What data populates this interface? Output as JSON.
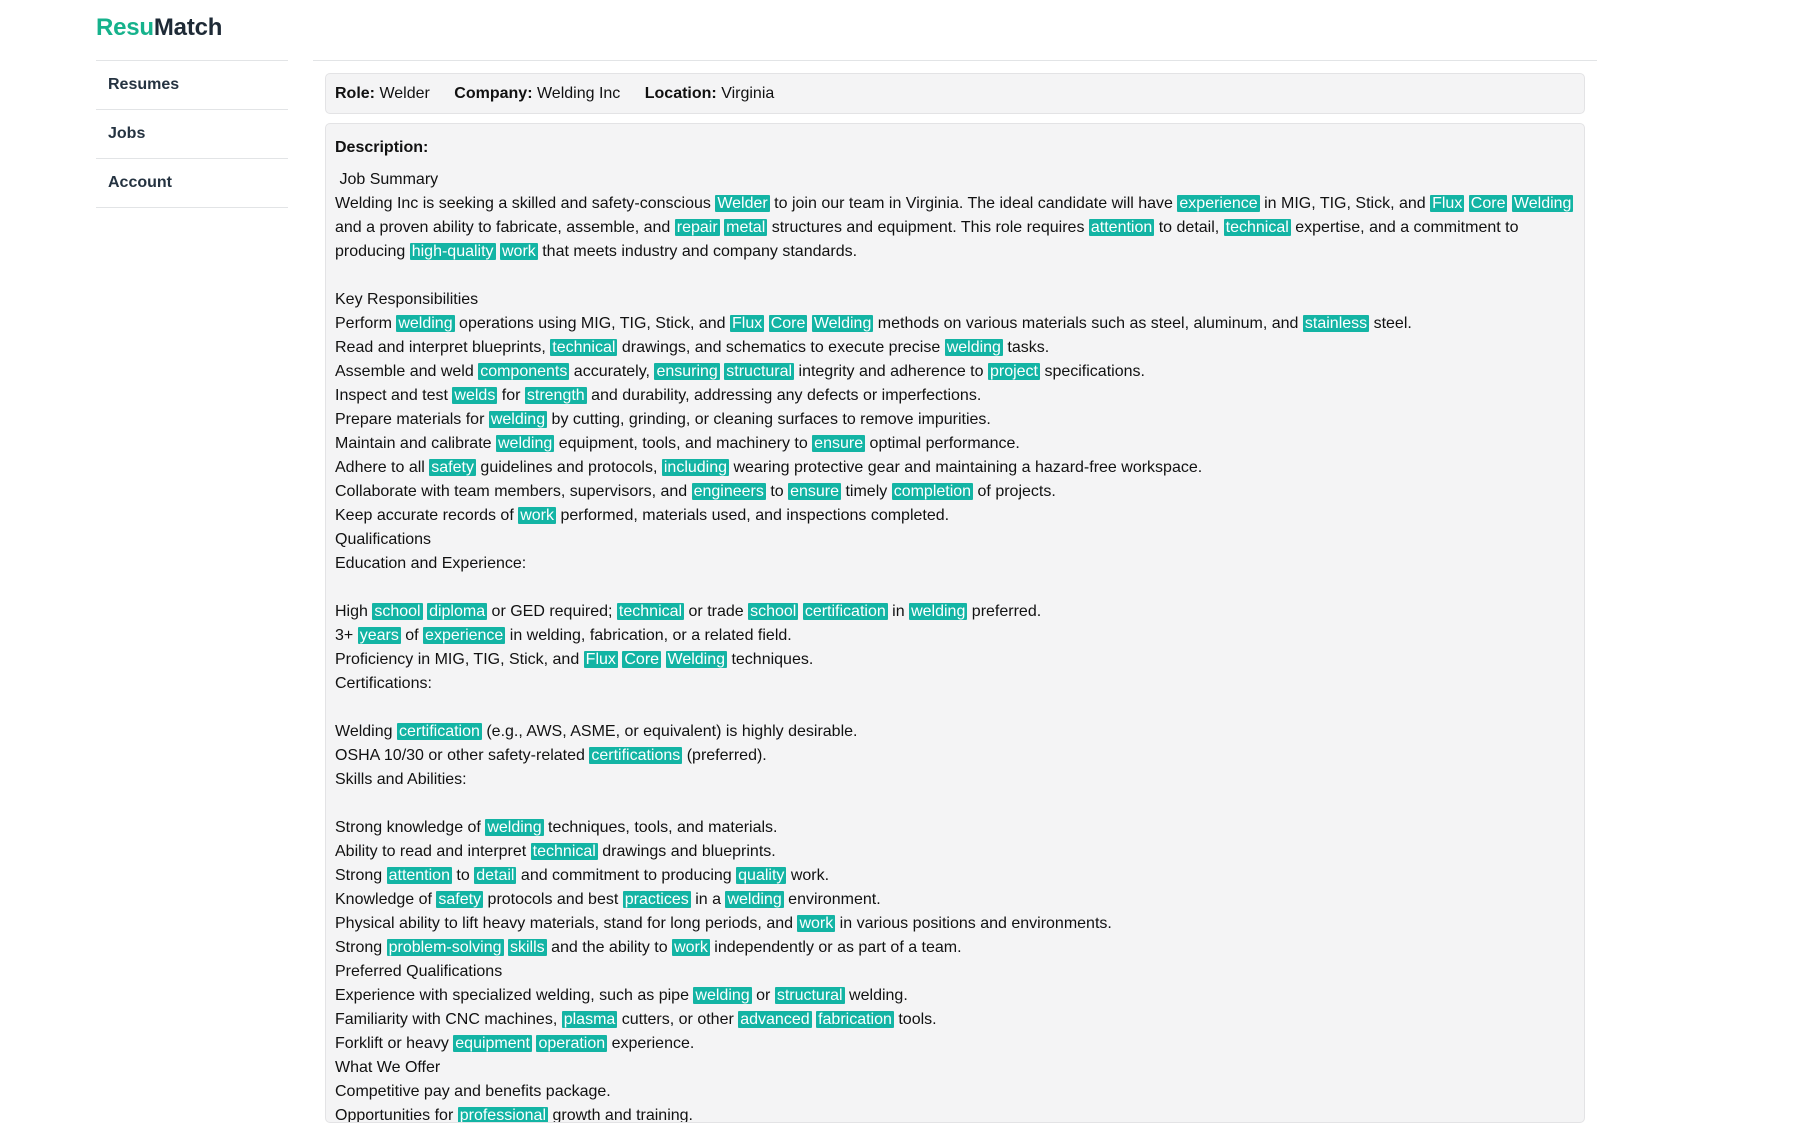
{
  "app": {
    "logo_part1": "Resu",
    "logo_part2": "Match",
    "accent_color": "#16b28c",
    "highlight_color": "#13b4a4"
  },
  "sidebar": {
    "items": [
      {
        "label": "Resumes"
      },
      {
        "label": "Jobs"
      },
      {
        "label": "Account"
      }
    ]
  },
  "job": {
    "role_label": "Role:",
    "role": "Welder",
    "company_label": "Company:",
    "company": "Welding Inc",
    "location_label": "Location:",
    "location": "Virginia",
    "description_label": "Description:",
    "description_segments": [
      {
        "t": " Job Summary\nWelding Inc is seeking a skilled and safety-conscious "
      },
      {
        "t": "Welder",
        "h": true
      },
      {
        "t": " to join our team in Virginia. The ideal candidate will have "
      },
      {
        "t": "experience",
        "h": true
      },
      {
        "t": " in MIG, TIG, Stick, and "
      },
      {
        "t": "Flux",
        "h": true
      },
      {
        "t": " "
      },
      {
        "t": "Core",
        "h": true
      },
      {
        "t": " "
      },
      {
        "t": "Welding",
        "h": true
      },
      {
        "t": " and a proven ability to fabricate, assemble, and "
      },
      {
        "t": "repair",
        "h": true
      },
      {
        "t": " "
      },
      {
        "t": "metal",
        "h": true
      },
      {
        "t": " structures and equipment. This role requires "
      },
      {
        "t": "attention",
        "h": true
      },
      {
        "t": " to detail, "
      },
      {
        "t": "technical",
        "h": true
      },
      {
        "t": " expertise, and a commitment to producing "
      },
      {
        "t": "high-quality",
        "h": true
      },
      {
        "t": " "
      },
      {
        "t": "work",
        "h": true
      },
      {
        "t": " that meets industry and company standards.\n\nKey Responsibilities\nPerform "
      },
      {
        "t": "welding",
        "h": true
      },
      {
        "t": " operations using MIG, TIG, Stick, and "
      },
      {
        "t": "Flux",
        "h": true
      },
      {
        "t": " "
      },
      {
        "t": "Core",
        "h": true
      },
      {
        "t": " "
      },
      {
        "t": "Welding",
        "h": true
      },
      {
        "t": " methods on various materials such as steel, aluminum, and "
      },
      {
        "t": "stainless",
        "h": true
      },
      {
        "t": " steel.\nRead and interpret blueprints, "
      },
      {
        "t": "technical",
        "h": true
      },
      {
        "t": " drawings, and schematics to execute precise "
      },
      {
        "t": "welding",
        "h": true
      },
      {
        "t": " tasks.\nAssemble and weld "
      },
      {
        "t": "components",
        "h": true
      },
      {
        "t": " accurately, "
      },
      {
        "t": "ensuring",
        "h": true
      },
      {
        "t": " "
      },
      {
        "t": "structural",
        "h": true
      },
      {
        "t": " integrity and adherence to "
      },
      {
        "t": "project",
        "h": true
      },
      {
        "t": " specifications.\nInspect and test "
      },
      {
        "t": "welds",
        "h": true
      },
      {
        "t": " for "
      },
      {
        "t": "strength",
        "h": true
      },
      {
        "t": " and durability, addressing any defects or imperfections.\nPrepare materials for "
      },
      {
        "t": "welding",
        "h": true
      },
      {
        "t": " by cutting, grinding, or cleaning surfaces to remove impurities.\nMaintain and calibrate "
      },
      {
        "t": "welding",
        "h": true
      },
      {
        "t": " equipment, tools, and machinery to "
      },
      {
        "t": "ensure",
        "h": true
      },
      {
        "t": " optimal performance.\nAdhere to all "
      },
      {
        "t": "safety",
        "h": true
      },
      {
        "t": " guidelines and protocols, "
      },
      {
        "t": "including",
        "h": true
      },
      {
        "t": " wearing protective gear and maintaining a hazard-free workspace.\nCollaborate with team members, supervisors, and "
      },
      {
        "t": "engineers",
        "h": true
      },
      {
        "t": " to "
      },
      {
        "t": "ensure",
        "h": true
      },
      {
        "t": " timely "
      },
      {
        "t": "completion",
        "h": true
      },
      {
        "t": " of projects.\nKeep accurate records of "
      },
      {
        "t": "work",
        "h": true
      },
      {
        "t": " performed, materials used, and inspections completed.\nQualifications\nEducation and Experience:\n\nHigh "
      },
      {
        "t": "school",
        "h": true
      },
      {
        "t": " "
      },
      {
        "t": "diploma",
        "h": true
      },
      {
        "t": " or GED required; "
      },
      {
        "t": "technical",
        "h": true
      },
      {
        "t": " or trade "
      },
      {
        "t": "school",
        "h": true
      },
      {
        "t": " "
      },
      {
        "t": "certification",
        "h": true
      },
      {
        "t": " in "
      },
      {
        "t": "welding",
        "h": true
      },
      {
        "t": " preferred.\n3+ "
      },
      {
        "t": "years",
        "h": true
      },
      {
        "t": " of "
      },
      {
        "t": "experience",
        "h": true
      },
      {
        "t": " in welding, fabrication, or a related field.\nProficiency in MIG, TIG, Stick, and "
      },
      {
        "t": "Flux",
        "h": true
      },
      {
        "t": " "
      },
      {
        "t": "Core",
        "h": true
      },
      {
        "t": " "
      },
      {
        "t": "Welding",
        "h": true
      },
      {
        "t": " techniques.\nCertifications:\n\nWelding "
      },
      {
        "t": "certification",
        "h": true
      },
      {
        "t": " (e.g., AWS, ASME, or equivalent) is highly desirable.\nOSHA 10/30 or other safety-related "
      },
      {
        "t": "certifications",
        "h": true
      },
      {
        "t": " (preferred).\nSkills and Abilities:\n\nStrong knowledge of "
      },
      {
        "t": "welding",
        "h": true
      },
      {
        "t": " techniques, tools, and materials.\nAbility to read and interpret "
      },
      {
        "t": "technical",
        "h": true
      },
      {
        "t": " drawings and blueprints.\nStrong "
      },
      {
        "t": "attention",
        "h": true
      },
      {
        "t": " to "
      },
      {
        "t": "detail",
        "h": true
      },
      {
        "t": " and commitment to producing "
      },
      {
        "t": "quality",
        "h": true
      },
      {
        "t": " work.\nKnowledge of "
      },
      {
        "t": "safety",
        "h": true
      },
      {
        "t": " protocols and best "
      },
      {
        "t": "practices",
        "h": true
      },
      {
        "t": " in a "
      },
      {
        "t": "welding",
        "h": true
      },
      {
        "t": " environment.\nPhysical ability to lift heavy materials, stand for long periods, and "
      },
      {
        "t": "work",
        "h": true
      },
      {
        "t": " in various positions and environments.\nStrong "
      },
      {
        "t": "problem-solving",
        "h": true
      },
      {
        "t": " "
      },
      {
        "t": "skills",
        "h": true
      },
      {
        "t": " and the ability to "
      },
      {
        "t": "work",
        "h": true
      },
      {
        "t": " independently or as part of a team.\nPreferred Qualifications\nExperience with specialized welding, such as pipe "
      },
      {
        "t": "welding",
        "h": true
      },
      {
        "t": " or "
      },
      {
        "t": "structural",
        "h": true
      },
      {
        "t": " welding.\nFamiliarity with CNC machines, "
      },
      {
        "t": "plasma",
        "h": true
      },
      {
        "t": " cutters, or other "
      },
      {
        "t": "advanced",
        "h": true
      },
      {
        "t": " "
      },
      {
        "t": "fabrication",
        "h": true
      },
      {
        "t": " tools.\nForklift or heavy "
      },
      {
        "t": "equipment",
        "h": true
      },
      {
        "t": " "
      },
      {
        "t": "operation",
        "h": true
      },
      {
        "t": " experience.\nWhat We Offer\nCompetitive pay and benefits package.\nOpportunities for "
      },
      {
        "t": "professional",
        "h": true
      },
      {
        "t": " growth and training."
      }
    ]
  }
}
